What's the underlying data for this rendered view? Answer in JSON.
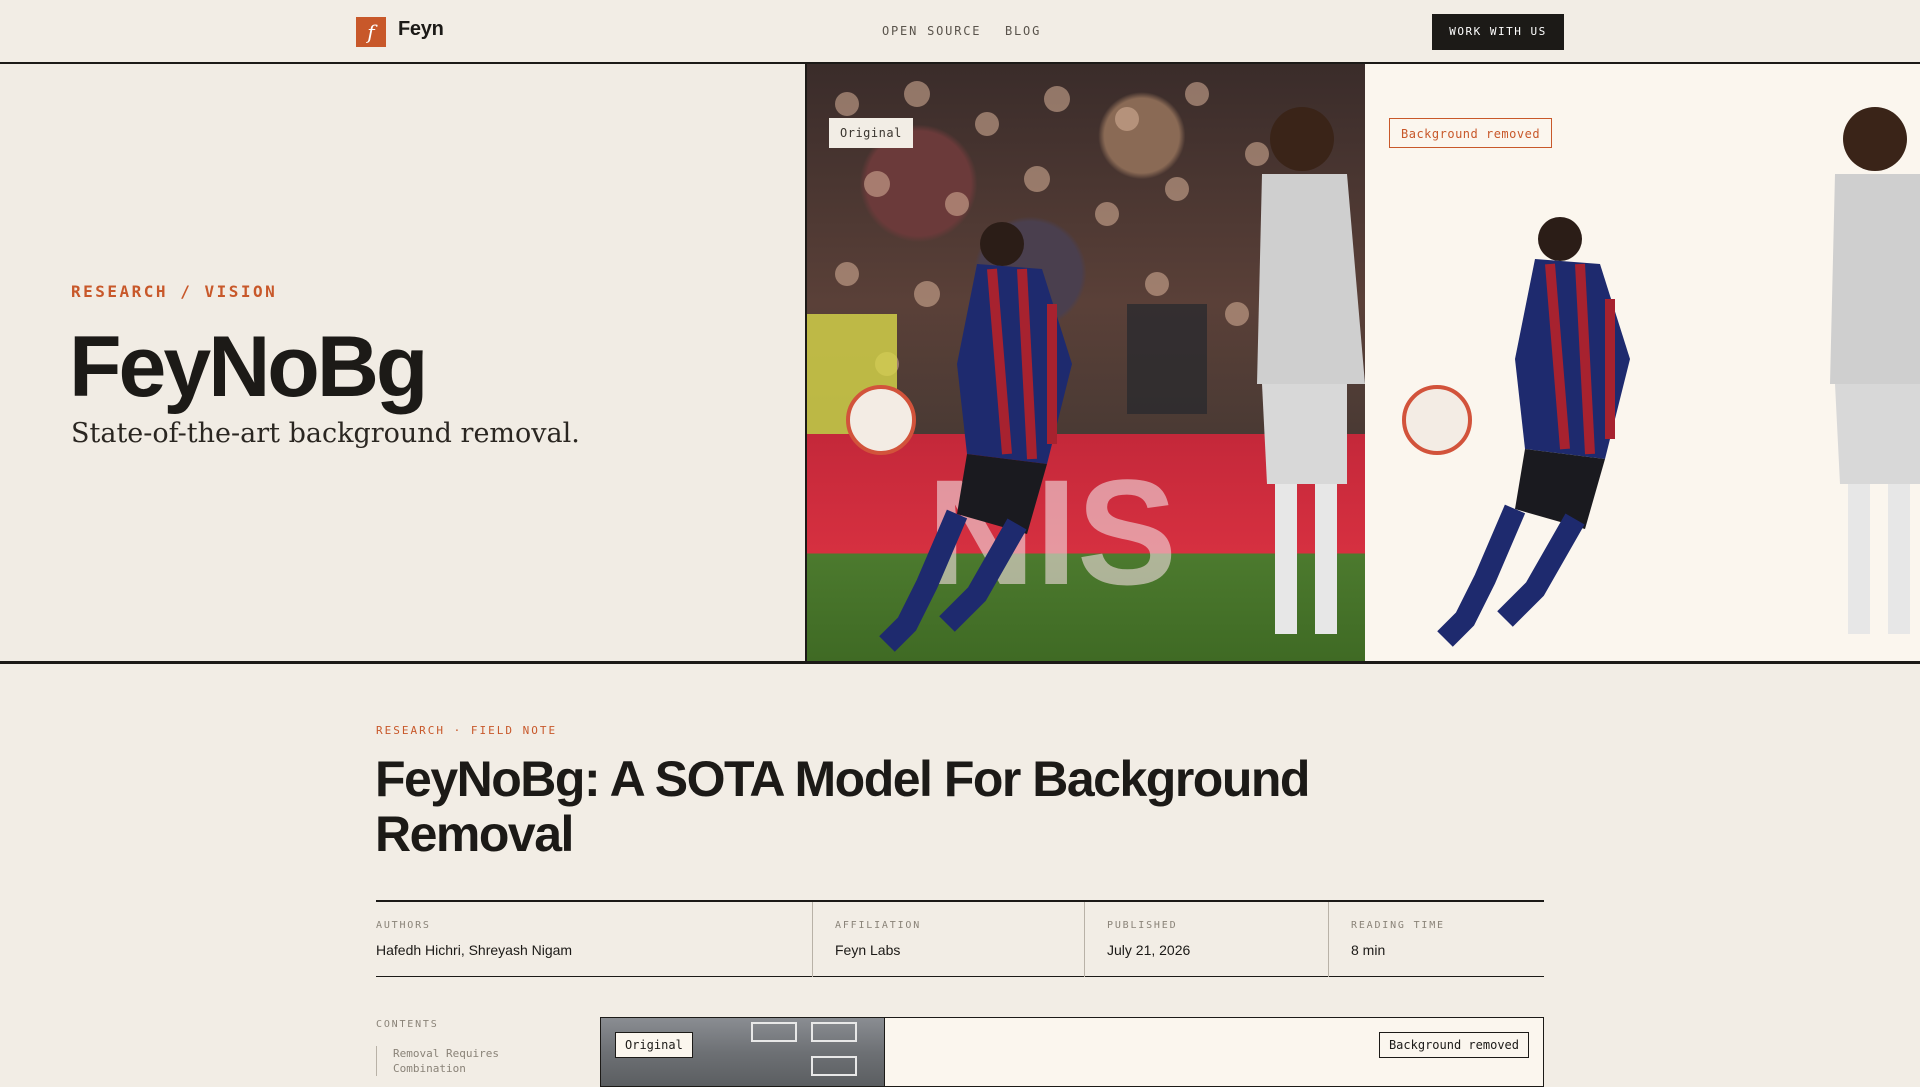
{
  "nav": {
    "logo_letter": "f",
    "brand": "Feyn",
    "links": [
      "OPEN SOURCE",
      "BLOG"
    ],
    "cta": "WORK WITH US"
  },
  "hero": {
    "eyebrow": "RESEARCH / VISION",
    "title": "FeyNoBg",
    "subtitle": "State-of-the-art background removal.",
    "badge_original": "Original",
    "badge_removed": "Background removed"
  },
  "article": {
    "eyebrow": "RESEARCH · FIELD NOTE",
    "title": "FeyNoBg: A SOTA Model For Background Removal",
    "meta": [
      {
        "label": "AUTHORS",
        "value": "Hafedh Hichri, Shreyash Nigam"
      },
      {
        "label": "AFFILIATION",
        "value": "Feyn Labs"
      },
      {
        "label": "PUBLISHED",
        "value": "July 21, 2026"
      },
      {
        "label": "READING TIME",
        "value": "8 min"
      }
    ],
    "contents_label": "CONTENTS",
    "contents_items": [
      "Removal Requires Combination"
    ],
    "figure_badge_original": "Original",
    "figure_badge_removed": "Background removed"
  },
  "colors": {
    "accent": "#c8582a",
    "ink": "#1c1a17",
    "paper": "#f2ede5"
  }
}
